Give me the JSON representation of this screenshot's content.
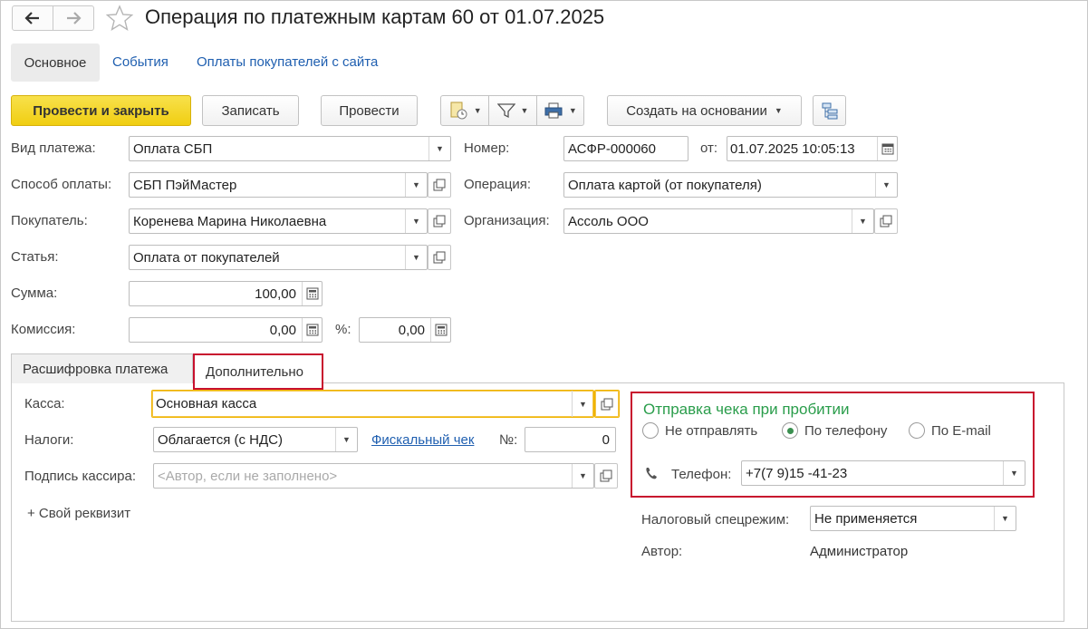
{
  "window": {
    "title": "Операция по платежным картам 60 от 01.07.2025"
  },
  "nav_tabs": {
    "main": "Основное",
    "events": "События",
    "site_payments": "Оплаты покупателей с сайта"
  },
  "toolbar": {
    "post_close": "Провести и закрыть",
    "save": "Записать",
    "post": "Провести",
    "create_based_on": "Создать на основании"
  },
  "form": {
    "payment_type": {
      "label": "Вид платежа:",
      "value": "Оплата СБП"
    },
    "payment_method": {
      "label": "Способ оплаты:",
      "value": "СБП ПэйМастер"
    },
    "buyer": {
      "label": "Покупатель:",
      "value": "Коренева Марина Николаевна"
    },
    "article": {
      "label": "Статья:",
      "value": "Оплата от покупателей"
    },
    "amount": {
      "label": "Сумма:",
      "value": "100,00"
    },
    "commission": {
      "label": "Комиссия:",
      "value": "0,00",
      "percent_label": "%:",
      "percent_value": "0,00"
    },
    "number": {
      "label": "Номер:",
      "value": "АСФР-000060",
      "date_label": "от:",
      "date_value": "01.07.2025 10:05:13"
    },
    "operation": {
      "label": "Операция:",
      "value": "Оплата картой (от покупателя)"
    },
    "organization": {
      "label": "Организация:",
      "value": "Ассоль ООО"
    }
  },
  "lower_tabs": {
    "breakdown": "Расшифровка платежа",
    "additional": "Дополнительно"
  },
  "additional": {
    "cashbox": {
      "label": "Касса:",
      "value": "Основная касса"
    },
    "taxes": {
      "label": "Налоги:",
      "value": "Облагается (с НДС)"
    },
    "fiscal_receipt_link": "Фискальный чек",
    "receipt_no": {
      "label": "№:",
      "value": "0"
    },
    "cashier_signature": {
      "label": "Подпись кассира:",
      "placeholder": "<Автор, если не заполнено>"
    },
    "custom_attr": "+ Свой реквизит",
    "receipt_group": {
      "title": "Отправка чека при пробитии",
      "options": [
        "Не отправлять",
        "По телефону",
        "По E-mail"
      ],
      "selected": "По телефону",
      "phone_label": "Телефон:",
      "phone_value": "+7(7 9)15 -41-23"
    },
    "tax_regime": {
      "label": "Налоговый спецрежим:",
      "value": "Не применяется"
    },
    "author": {
      "label": "Автор:",
      "value": "Администратор"
    }
  },
  "colors": {
    "primary_button": "#f0ce12",
    "link": "#1f5fb0",
    "group_title": "#2a9d4b",
    "highlight_border": "#c8102e"
  }
}
